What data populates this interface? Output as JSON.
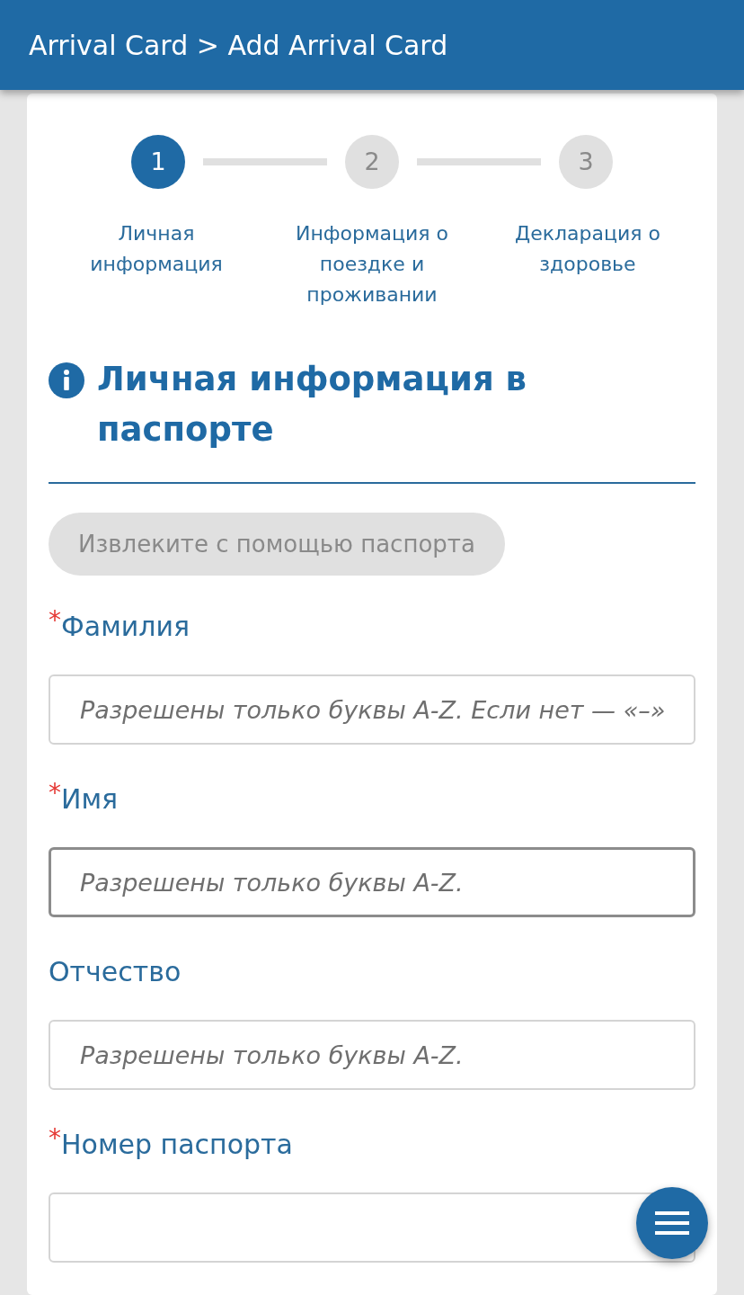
{
  "header": {
    "title": "Arrival Card > Add Arrival Card"
  },
  "steps": [
    {
      "number": "1",
      "label": "Личная информация",
      "selected": true
    },
    {
      "number": "2",
      "label": "Информация о поездке и проживании",
      "selected": false
    },
    {
      "number": "3",
      "label": "Декларация о здоровье",
      "selected": false
    }
  ],
  "section": {
    "title": "Личная информация в паспорте"
  },
  "extract_button": {
    "label": "Извлеките с помощью паспорта",
    "disabled": true
  },
  "fields": [
    {
      "required_mark": "*",
      "label": "Фамилия",
      "placeholder": "Разрешены только буквы A-Z. Если нет — «–»",
      "focused": false
    },
    {
      "required_mark": "*",
      "label": "Имя",
      "placeholder": "Разрешены только буквы A-Z.",
      "focused": true
    },
    {
      "label": "Отчество",
      "placeholder": "Разрешены только буквы A-Z.",
      "focused": false
    },
    {
      "required_mark": "*",
      "label": "Номер паспорта",
      "focused": false
    }
  ]
}
